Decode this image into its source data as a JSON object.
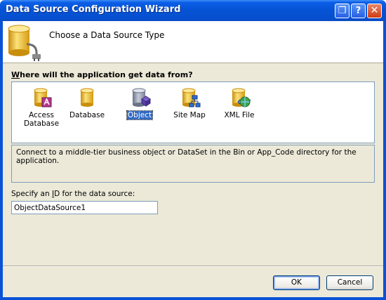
{
  "window": {
    "title": "Data Source Configuration Wizard",
    "help_glyph": "?",
    "close_glyph": "✕",
    "restore_glyph": "❐"
  },
  "header": {
    "title": "Choose a Data Source Type",
    "icon": "database-plug-icon"
  },
  "question": {
    "accel": "W",
    "rest": "here will the application get data from?"
  },
  "sources": [
    {
      "label_line1": "Access",
      "label_line2": "Database",
      "icon": "access-database-icon",
      "selected": false
    },
    {
      "label_line1": "Database",
      "label_line2": "",
      "icon": "database-icon",
      "selected": false
    },
    {
      "label_line1": "Object",
      "label_line2": "",
      "icon": "object-icon",
      "selected": true
    },
    {
      "label_line1": "Site Map",
      "label_line2": "",
      "icon": "site-map-icon",
      "selected": false
    },
    {
      "label_line1": "XML File",
      "label_line2": "",
      "icon": "xml-file-icon",
      "selected": false
    }
  ],
  "description": "Connect to a middle-tier business object or DataSet in the Bin or App_Code directory for the application.",
  "id_field": {
    "label_before": "Specify an ",
    "label_accel": "I",
    "label_after": "D for the data source:",
    "value": "ObjectDataSource1"
  },
  "buttons": {
    "ok": "OK",
    "cancel": "Cancel"
  },
  "colors": {
    "titlebar": "#0653d4",
    "dialog_bg": "#ece9d8",
    "selection": "#316ac5",
    "cylinder_gold": "#f2c230"
  }
}
